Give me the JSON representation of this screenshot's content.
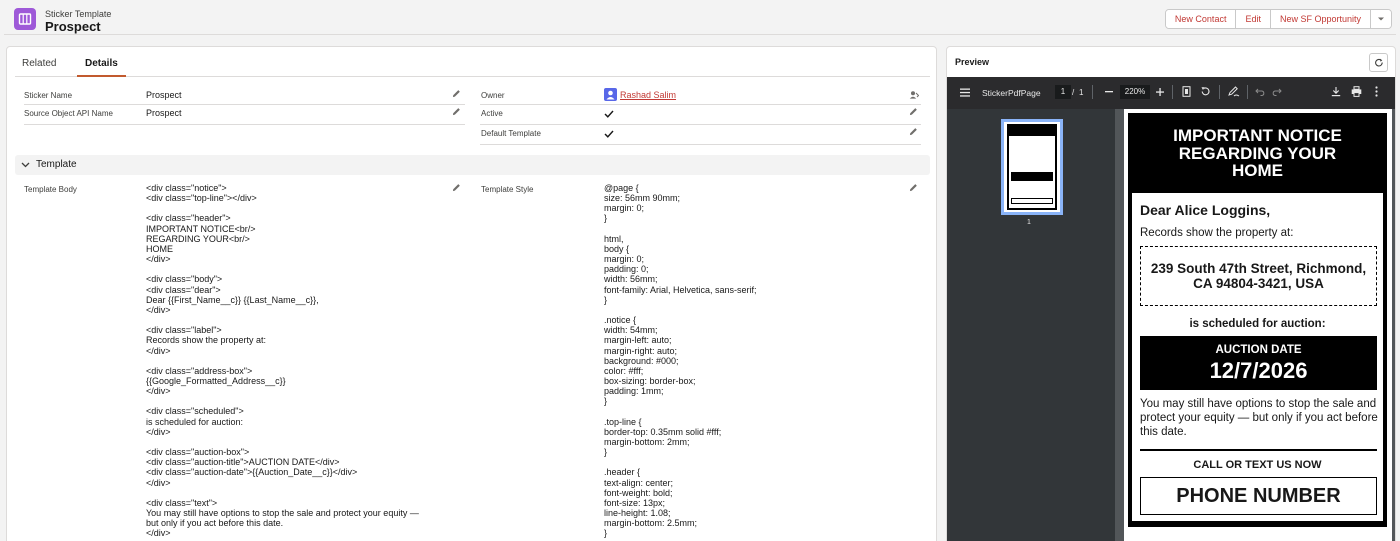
{
  "header": {
    "object_type": "Sticker Template",
    "record_name": "Prospect",
    "buttons": [
      "New Contact",
      "Edit",
      "New SF Opportunity"
    ]
  },
  "tabs": [
    "Related",
    "Details"
  ],
  "fields": {
    "sticker_name_label": "Sticker Name",
    "sticker_name_value": "Prospect",
    "source_api_label": "Source Object API Name",
    "source_api_value": "Prospect",
    "owner_label": "Owner",
    "owner_value": "Rashad Salim",
    "active_label": "Active",
    "default_template_label": "Default Template"
  },
  "section": {
    "title": "Template"
  },
  "template_body": {
    "label": "Template Body",
    "lines": [
      "<div class=\"notice\">",
      "<div class=\"top-line\"></div>",
      "",
      "<div class=\"header\">",
      "IMPORTANT NOTICE<br/>",
      "REGARDING YOUR<br/>",
      "HOME",
      "</div>",
      "",
      "<div class=\"body\">",
      "<div class=\"dear\">",
      "Dear {{First_Name__c}} {{Last_Name__c}},",
      "</div>",
      "",
      "<div class=\"label\">",
      "Records show the property at:",
      "</div>",
      "",
      "<div class=\"address-box\">",
      "{{Google_Formatted_Address__c}}",
      "</div>",
      "",
      "<div class=\"scheduled\">",
      "is scheduled for auction:",
      "</div>",
      "",
      "<div class=\"auction-box\">",
      "<div class=\"auction-title\">AUCTION DATE</div>",
      "<div class=\"auction-date\">{{Auction_Date__c}}</div>",
      "</div>",
      "",
      "<div class=\"text\">",
      "You may still have options to stop the sale and protect your equity —",
      "but only if you act before this date.",
      "</div>"
    ]
  },
  "template_style": {
    "label": "Template Style",
    "lines": [
      "@page {",
      "size: 56mm 90mm;",
      "margin: 0;",
      "}",
      "",
      "html,",
      "body {",
      "margin: 0;",
      "padding: 0;",
      "width: 56mm;",
      "font-family: Arial, Helvetica, sans-serif;",
      "}",
      "",
      ".notice {",
      "width: 54mm;",
      "margin-left: auto;",
      "margin-right: auto;",
      "background: #000;",
      "color: #fff;",
      "box-sizing: border-box;",
      "padding: 1mm;",
      "}",
      "",
      ".top-line {",
      "border-top: 0.35mm solid #fff;",
      "margin-bottom: 2mm;",
      "}",
      "",
      ".header {",
      "text-align: center;",
      "font-weight: bold;",
      "font-size: 13px;",
      "line-height: 1.08;",
      "margin-bottom: 2.5mm;",
      "}"
    ]
  },
  "preview": {
    "title": "Preview",
    "pdf_title": "StickerPdfPage",
    "page_current": "1",
    "page_sep": "/",
    "page_total": "1",
    "zoom": "220%",
    "thumb_number": "1",
    "notice": {
      "header_lines": [
        "IMPORTANT NOTICE",
        "REGARDING YOUR",
        "HOME"
      ],
      "dear": "Dear Alice Loggins,",
      "label": "Records show the property at:",
      "address": "239 South 47th Street, Richmond, CA 94804-3421, USA",
      "scheduled": "is scheduled for auction:",
      "auction_title": "AUCTION DATE",
      "auction_date": "12/7/2026",
      "text": "You may still have options to stop the sale and protect your equity — but only if you act before this date.",
      "call": "CALL OR TEXT US NOW",
      "phone": "PHONE NUMBER"
    }
  },
  "colors": {
    "brand_icon": "#9e59d8",
    "link": "#c23934",
    "active_tab": "#c25a2e",
    "thumb_border": "#8ab4f8"
  }
}
